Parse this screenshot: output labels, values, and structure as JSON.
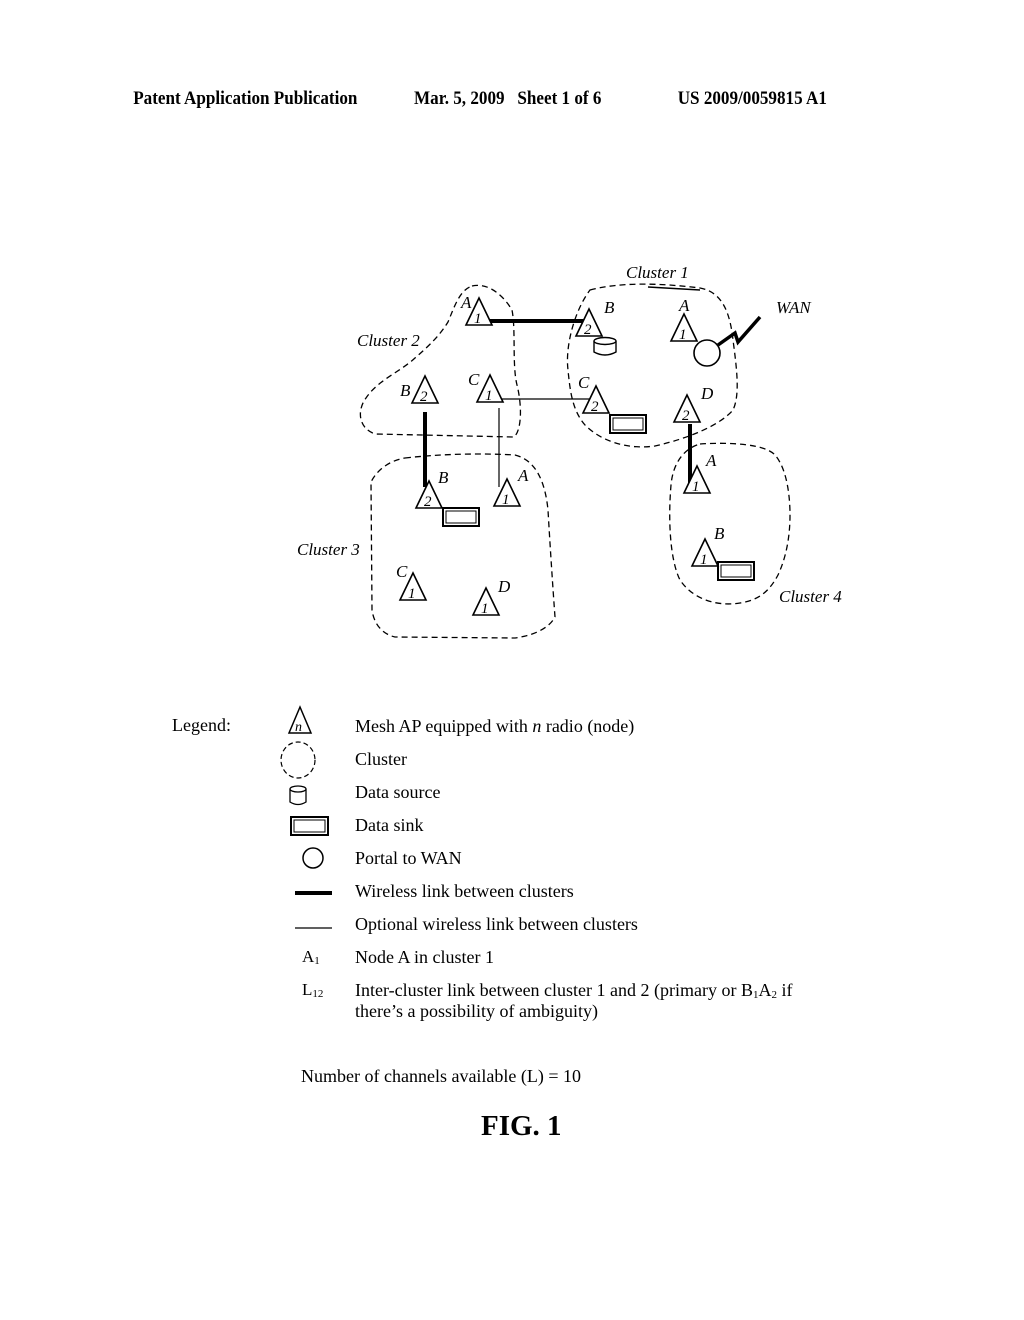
{
  "header": {
    "publication": "Patent Application Publication",
    "date_sheet": "Mar. 5, 2009   Sheet 1 of 6",
    "number": "US 2009/0059815 A1"
  },
  "diagram": {
    "clusters": [
      {
        "id": "cluster-1",
        "label": "Cluster 1"
      },
      {
        "id": "cluster-2",
        "label": "Cluster 2"
      },
      {
        "id": "cluster-3",
        "label": "Cluster 3"
      },
      {
        "id": "cluster-4",
        "label": "Cluster 4"
      }
    ],
    "wan_label": "WAN",
    "nodes": [
      {
        "cluster": "2",
        "name": "A",
        "radios": "1"
      },
      {
        "cluster": "2",
        "name": "B",
        "radios": "2"
      },
      {
        "cluster": "2",
        "name": "C",
        "radios": "1"
      },
      {
        "cluster": "1",
        "name": "B",
        "radios": "2",
        "attachment": "data source"
      },
      {
        "cluster": "1",
        "name": "A",
        "radios": "1",
        "attachment": "portal to WAN"
      },
      {
        "cluster": "1",
        "name": "C",
        "radios": "2",
        "attachment": "data sink"
      },
      {
        "cluster": "1",
        "name": "D",
        "radios": "2"
      },
      {
        "cluster": "3",
        "name": "B",
        "radios": "2",
        "attachment": "data sink"
      },
      {
        "cluster": "3",
        "name": "A",
        "radios": "1"
      },
      {
        "cluster": "3",
        "name": "C",
        "radios": "1"
      },
      {
        "cluster": "3",
        "name": "D",
        "radios": "1"
      },
      {
        "cluster": "4",
        "name": "A",
        "radios": "1"
      },
      {
        "cluster": "4",
        "name": "B",
        "radios": "1",
        "attachment": "data sink"
      }
    ],
    "links": [
      {
        "from": "A2",
        "to": "B1",
        "type": "wireless link between clusters"
      },
      {
        "from": "C2",
        "to": "C1",
        "type": "optional wireless link between clusters"
      },
      {
        "from": "B2",
        "to": "B3",
        "type": "wireless link between clusters"
      },
      {
        "from": "C2",
        "to": "A3",
        "type": "optional wireless link between clusters"
      },
      {
        "from": "D1",
        "to": "A4",
        "type": "wireless link between clusters"
      }
    ]
  },
  "legend": {
    "title": "Legend:",
    "node_symbol": "n",
    "items": [
      {
        "icon": "triangle-node-icon",
        "pre": "Mesh AP equipped with ",
        "em": "n",
        "post": " radio (node)"
      },
      {
        "icon": "dashed-cluster-icon",
        "text": "Cluster"
      },
      {
        "icon": "cylinder-data-source-icon",
        "text": "Data source"
      },
      {
        "icon": "rectangle-data-sink-icon",
        "text": "Data sink"
      },
      {
        "icon": "circle-portal-icon",
        "text": "Portal to WAN"
      },
      {
        "icon": "thick-line-icon",
        "text": "Wireless link between clusters"
      },
      {
        "icon": "thin-line-icon",
        "text": "Optional wireless link between clusters"
      }
    ],
    "node_notation": {
      "key_letter": "A",
      "key_sub": "1",
      "text": "Node A in cluster 1"
    },
    "link_notation": {
      "key_letter": "L",
      "key_sub": "12",
      "text_line1_pre": "Inter-cluster link between cluster 1 and 2 (primary or B",
      "text_sub1": "1",
      "text_mid": "A",
      "text_sub2": "2",
      "text_line1_post": " if",
      "text_line2": "there’s a possibility of ambiguity)"
    }
  },
  "channels_text": "Number of channels available (L) = 10",
  "figure_label": "FIG. 1"
}
